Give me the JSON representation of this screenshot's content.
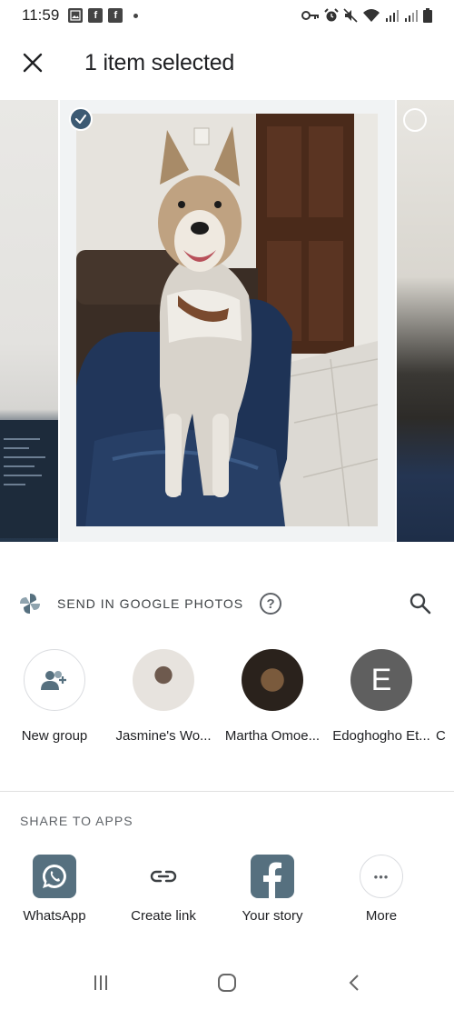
{
  "status_bar": {
    "time": "11:59",
    "notification_icons": [
      "gallery-icon",
      "facebook-icon",
      "facebook-icon"
    ],
    "system_icons": [
      "key-icon",
      "alarm-icon",
      "mute-icon",
      "wifi-icon",
      "signal-icon",
      "signal-icon",
      "battery-icon"
    ]
  },
  "header": {
    "close_icon": "close-icon",
    "title": "1 item selected"
  },
  "photos": {
    "selected_count": 1,
    "accent": "#3c5a73"
  },
  "send": {
    "label": "SEND IN GOOGLE PHOTOS",
    "help_glyph": "?",
    "search_icon": "search-icon"
  },
  "contacts": [
    {
      "name": "New group",
      "avatar": "add-group-icon"
    },
    {
      "name": "Jasmine's Wo...",
      "avatar": "photo"
    },
    {
      "name": "Martha Omoe...",
      "avatar": "photo"
    },
    {
      "name": "Edoghogho Et...",
      "avatar": "letter",
      "letter": "E"
    },
    {
      "name": "C",
      "avatar": "photo"
    }
  ],
  "share": {
    "heading": "SHARE TO APPS",
    "apps": [
      {
        "label": "WhatsApp",
        "icon": "whatsapp-icon"
      },
      {
        "label": "Create link",
        "icon": "link-icon"
      },
      {
        "label": "Your story",
        "icon": "facebook-icon"
      },
      {
        "label": "More",
        "icon": "more-icon",
        "glyph": "•••"
      }
    ]
  },
  "nav": {
    "recents": "recents-icon",
    "home": "home-icon",
    "back": "back-icon"
  }
}
